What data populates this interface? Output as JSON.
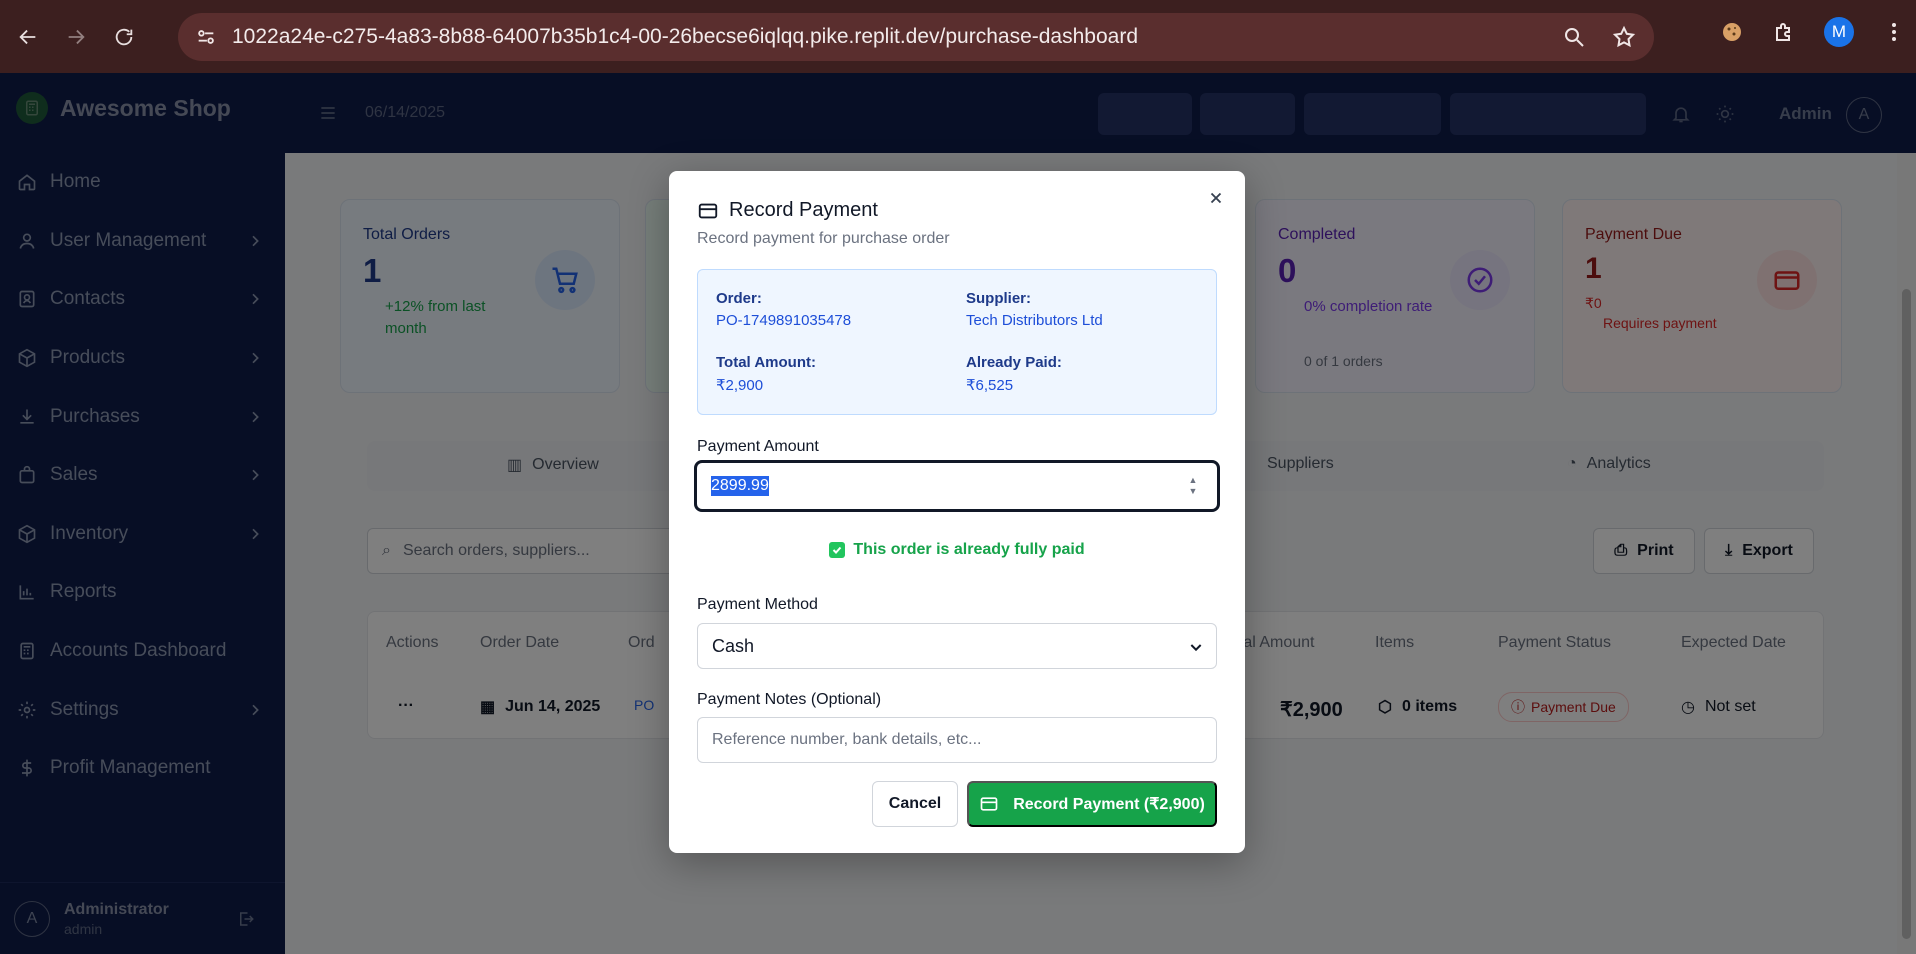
{
  "browser": {
    "url": "1022a24e-c275-4a83-8b88-64007b35b1c4-00-26becse6iqlqq.pike.replit.dev/purchase-dashboard",
    "profile_initial": "M"
  },
  "brand": {
    "name": "Awesome Shop"
  },
  "sidebar": {
    "items": [
      {
        "label": "Home",
        "icon": "home-icon",
        "has_children": false
      },
      {
        "label": "User Management",
        "icon": "user-icon",
        "has_children": true
      },
      {
        "label": "Contacts",
        "icon": "contacts-icon",
        "has_children": true
      },
      {
        "label": "Products",
        "icon": "box-icon",
        "has_children": true
      },
      {
        "label": "Purchases",
        "icon": "download-icon",
        "has_children": true
      },
      {
        "label": "Sales",
        "icon": "bag-icon",
        "has_children": true
      },
      {
        "label": "Inventory",
        "icon": "box-icon",
        "has_children": true
      },
      {
        "label": "Reports",
        "icon": "bar-chart-icon",
        "has_children": false
      },
      {
        "label": "Accounts Dashboard",
        "icon": "calculator-icon",
        "has_children": false
      },
      {
        "label": "Settings",
        "icon": "gear-icon",
        "has_children": true
      },
      {
        "label": "Profit Management",
        "icon": "dollar-icon",
        "has_children": false
      }
    ],
    "footer": {
      "name": "Administrator",
      "role": "admin",
      "avatar_initial": "A"
    }
  },
  "header": {
    "date": "06/14/2025",
    "admin_label": "Admin",
    "avatar_initial": "A"
  },
  "cards": [
    {
      "title": "Total Orders",
      "value": "1",
      "sub": "+12% from last month",
      "color": "#1e3a8a"
    },
    {
      "title": "Completed",
      "value": "0",
      "sub": "0% completion rate",
      "sub2": "0 of 1 orders",
      "color": "#5b21b6"
    },
    {
      "title": "Payment Due",
      "value": "1",
      "sub": "₹0",
      "sub2": "Requires payment",
      "color": "#991b1b"
    }
  ],
  "tabs": [
    "Overview",
    "Suppliers",
    "Analytics"
  ],
  "toolbar": {
    "search_placeholder": "Search orders, suppliers...",
    "print_label": "Print",
    "export_label": "Export"
  },
  "table": {
    "headers": [
      "Actions",
      "Order Date",
      "Ord",
      "otal Amount",
      "Items",
      "Payment Status",
      "Expected Date"
    ],
    "row": {
      "actions": "···",
      "order_date": "Jun 14, 2025",
      "order_no": "PO",
      "total": "₹2,900",
      "items": "0 items",
      "payment_status": "Payment Due",
      "expected": "Not set"
    }
  },
  "modal": {
    "title": "Record Payment",
    "description": "Record payment for purchase order",
    "order_label": "Order:",
    "order_value": "PO-1749891035478",
    "supplier_label": "Supplier:",
    "supplier_value": "Tech Distributors Ltd",
    "total_label": "Total Amount:",
    "total_value": "₹2,900",
    "paid_label": "Already Paid:",
    "paid_value": "₹6,525",
    "amount_label": "Payment Amount",
    "amount_value": "2899.99",
    "fully_paid_text": "This order is already fully paid",
    "method_label": "Payment Method",
    "method_value": "Cash",
    "notes_label": "Payment Notes (Optional)",
    "notes_placeholder": "Reference number, bank details, etc...",
    "cancel_label": "Cancel",
    "record_label": "Record Payment (₹2,900)",
    "accent_green": "#16a34a"
  }
}
